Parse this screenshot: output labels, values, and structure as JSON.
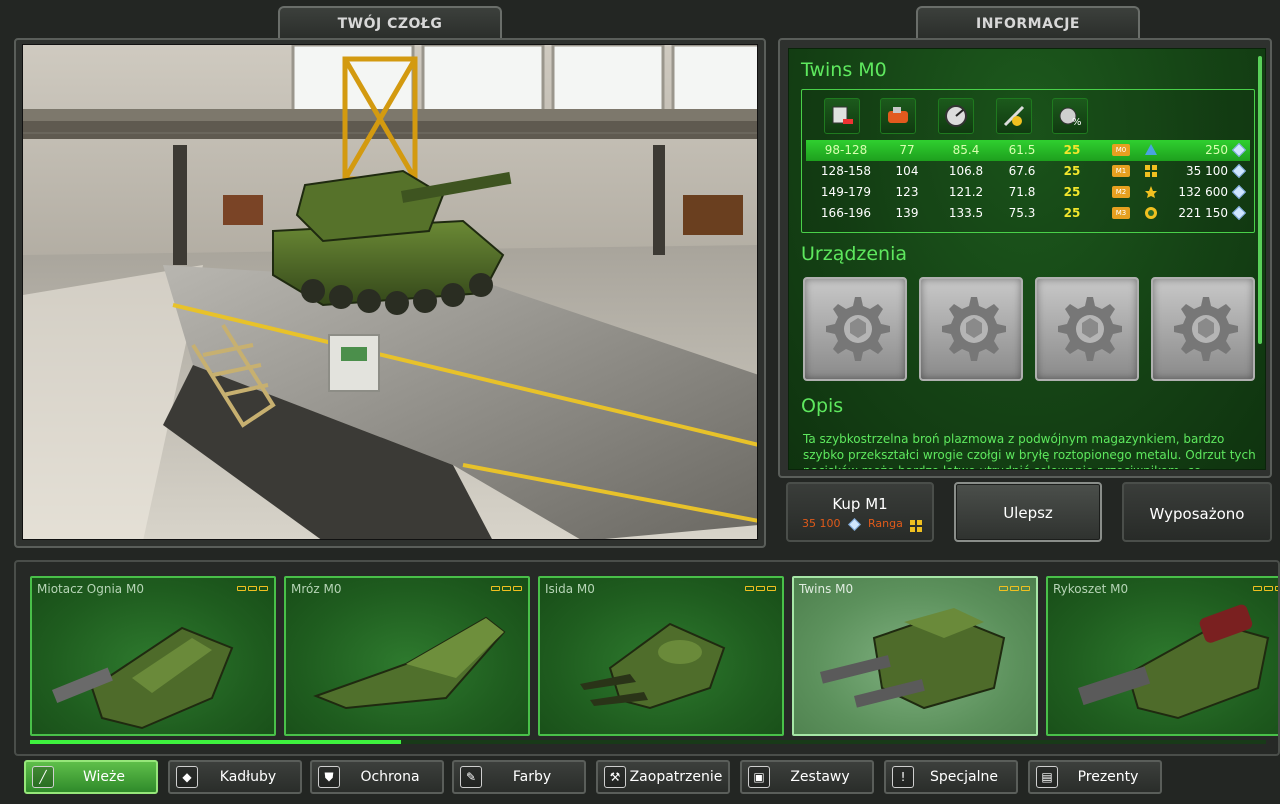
{
  "headers": {
    "garage_title": "TWÓJ CZOŁG",
    "info_title": "INFORMACJE"
  },
  "info": {
    "item_name": "Twins M0",
    "stat_icons": [
      "damage-icon",
      "impact-force-icon",
      "range-icon",
      "rate-of-fire-icon",
      "reload-icon"
    ],
    "rows": [
      {
        "c0": "98-128",
        "c1": "77",
        "c2": "85.4",
        "c3": "61.5",
        "c4": "25",
        "badge": "M0",
        "price": "250"
      },
      {
        "c0": "128-158",
        "c1": "104",
        "c2": "106.8",
        "c3": "67.6",
        "c4": "25",
        "badge": "M1",
        "price": "35 100"
      },
      {
        "c0": "149-179",
        "c1": "123",
        "c2": "121.2",
        "c3": "71.8",
        "c4": "25",
        "badge": "M2",
        "price": "132 600"
      },
      {
        "c0": "166-196",
        "c1": "139",
        "c2": "133.5",
        "c3": "75.3",
        "c4": "25",
        "badge": "M3",
        "price": "221 150"
      }
    ],
    "devices_title": "Urządzenia",
    "desc_title": "Opis",
    "description": "Ta szybkostrzelna broń plazmowa z podwójnym magazynkiem, bardzo szybko przekształci wrogie czołgi w bryłę roztopionego metalu. Odrzut tych pocisków może bardzo łatwo utrudnić celowanie przeciwnikom, co"
  },
  "actions": {
    "buy_label": "Kup M1",
    "buy_price": "35 100",
    "buy_rank_label": "Ranga",
    "upgrade_label": "Ulepsz",
    "equipped_label": "Wyposażono"
  },
  "items": [
    {
      "name": "Miotacz Ognia M0"
    },
    {
      "name": "Mróz M0"
    },
    {
      "name": "Isida M0"
    },
    {
      "name": "Twins M0"
    },
    {
      "name": "Rykoszet M0"
    }
  ],
  "items_scroll_progress": 0.3,
  "categories": [
    {
      "label": "Wieże",
      "icon": "turret-icon"
    },
    {
      "label": "Kadłuby",
      "icon": "hull-icon"
    },
    {
      "label": "Ochrona",
      "icon": "shield-icon"
    },
    {
      "label": "Farby",
      "icon": "paint-icon"
    },
    {
      "label": "Zaopatrzenie",
      "icon": "wrench-icon"
    },
    {
      "label": "Zestawy",
      "icon": "kit-icon"
    },
    {
      "label": "Specjalne",
      "icon": "exclamation-icon"
    },
    {
      "label": "Prezenty",
      "icon": "gift-icon"
    }
  ],
  "colors": {
    "accent_green": "#5ee85e",
    "selected_row": "#2fcf2f",
    "upgrade_orange": "#e05a1a"
  }
}
